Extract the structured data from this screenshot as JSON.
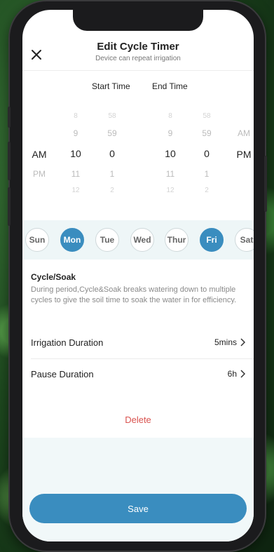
{
  "header": {
    "title": "Edit Cycle Timer",
    "subtitle": "Device can repeat irrigation",
    "close_icon": "close-icon"
  },
  "columns": {
    "start_label": "Start Time",
    "end_label": "End Time"
  },
  "start_picker": {
    "ampm": [
      "AM",
      "PM"
    ],
    "hours": [
      "8",
      "9",
      "10",
      "11",
      "12"
    ],
    "minutes": [
      "58",
      "59",
      "0",
      "1",
      "2"
    ],
    "selected": {
      "ampm": "AM",
      "hour": "10",
      "minute": "0"
    }
  },
  "end_picker": {
    "hours": [
      "8",
      "9",
      "10",
      "11",
      "12"
    ],
    "minutes": [
      "58",
      "59",
      "0",
      "1",
      "2"
    ],
    "ampm": [
      "AM",
      "PM"
    ],
    "selected": {
      "ampm": "PM",
      "hour": "10",
      "minute": "0"
    }
  },
  "days": [
    {
      "label": "Sun",
      "active": false
    },
    {
      "label": "Mon",
      "active": true
    },
    {
      "label": "Tue",
      "active": false
    },
    {
      "label": "Wed",
      "active": false
    },
    {
      "label": "Thur",
      "active": false
    },
    {
      "label": "Fri",
      "active": true
    },
    {
      "label": "Sat",
      "active": false
    }
  ],
  "cycle_soak": {
    "title": "Cycle/Soak",
    "description": "During period,Cycle&Soak breaks watering down to multiple cycles to give the soil time to soak the water in for efficiency."
  },
  "settings": {
    "irrigation_label": "Irrigation Duration",
    "irrigation_value": "5mins",
    "pause_label": "Pause  Duration",
    "pause_value": "6h"
  },
  "actions": {
    "delete_label": "Delete",
    "save_label": "Save"
  },
  "colors": {
    "accent": "#3a8dbf",
    "delete": "#d9534f"
  }
}
